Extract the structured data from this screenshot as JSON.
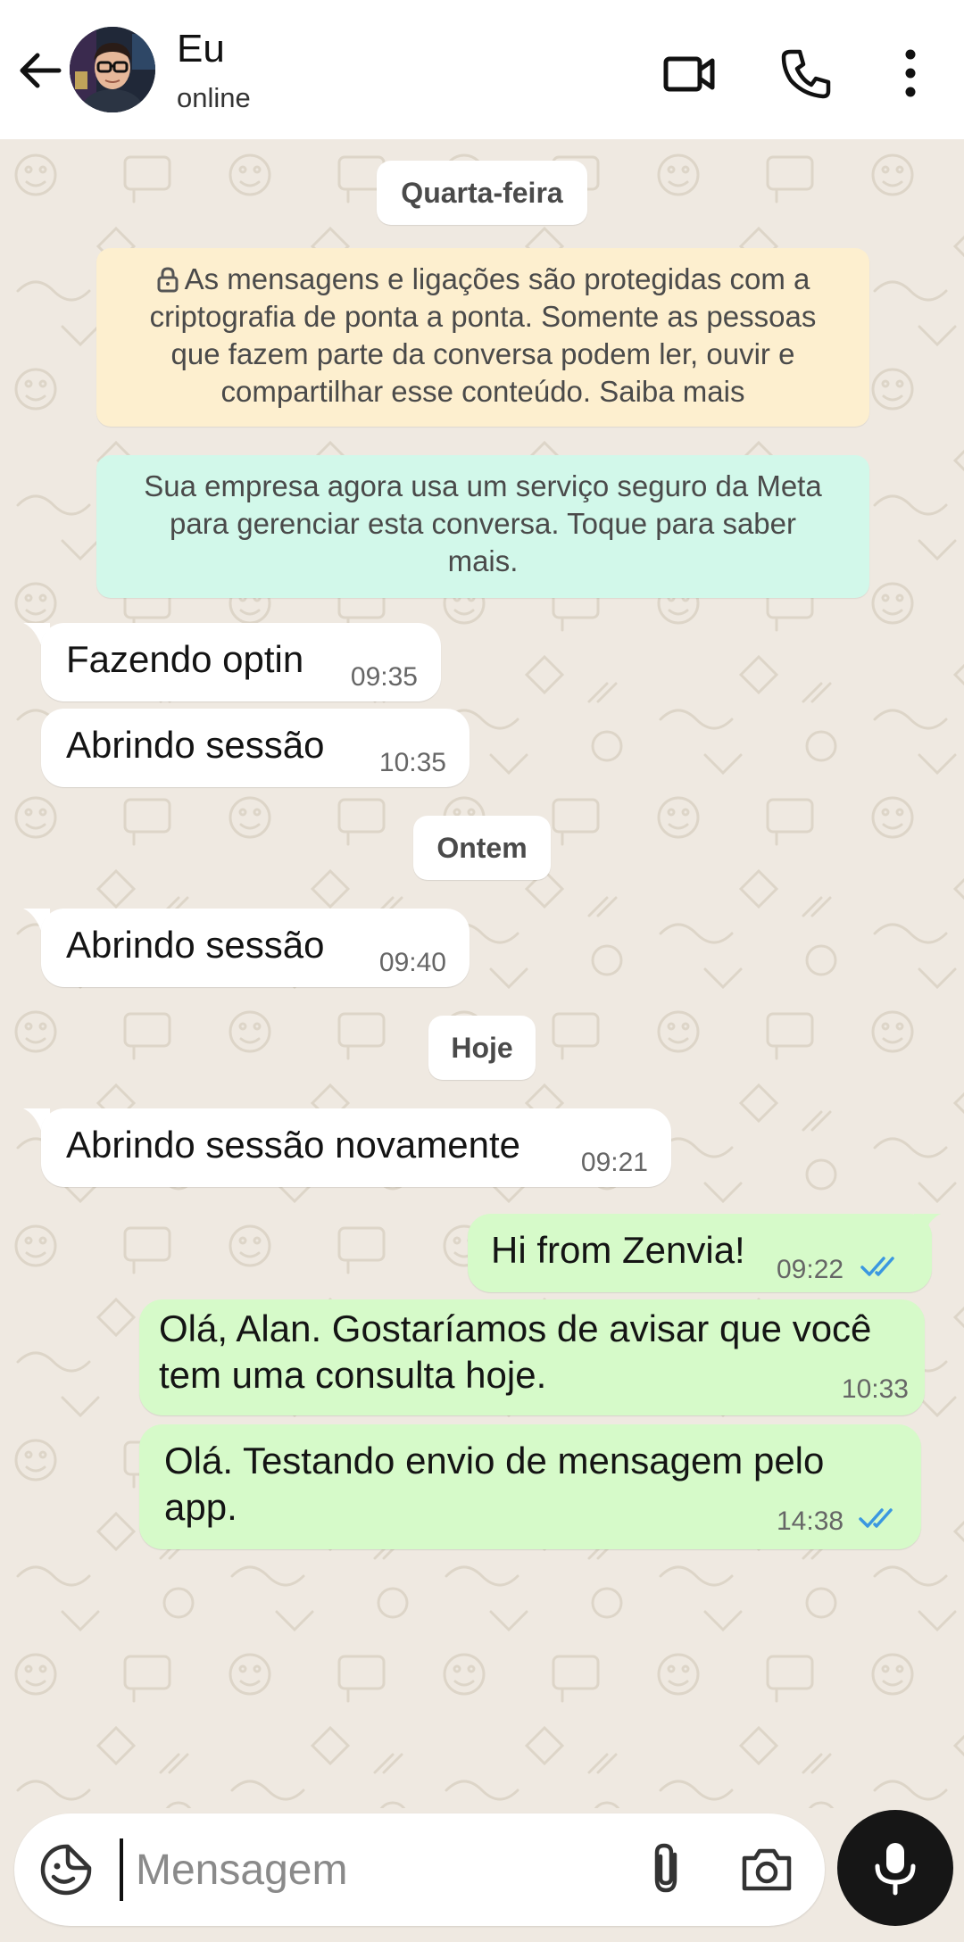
{
  "header": {
    "name": "Eu",
    "status": "online"
  },
  "chips": {
    "quarta": "Quarta-feira",
    "ontem": "Ontem",
    "hoje": "Hoje"
  },
  "notices": {
    "encryption_lines": [
      "As mensagens e ligações são protegidas com a",
      "criptografia de ponta a ponta. Somente as pessoas",
      "que fazem parte da conversa podem ler, ouvir e",
      "compartilhar esse conteúdo. Saiba mais"
    ],
    "meta_lines": [
      "Sua empresa agora usa um serviço seguro da Meta",
      "para gerenciar esta conversa. Toque para saber",
      "mais."
    ]
  },
  "messages": [
    {
      "text": "Fazendo optin",
      "time": "09:35"
    },
    {
      "text": "Abrindo sessão",
      "time": "10:35"
    },
    {
      "text": "Abrindo sessão",
      "time": "09:40"
    },
    {
      "text": "Abrindo sessão novamente",
      "time": "09:21"
    },
    {
      "text": "Hi from Zenvia!",
      "time": "09:22"
    },
    {
      "lines": [
        "Olá, Alan. Gostaríamos de avisar que você",
        "tem uma consulta hoje."
      ],
      "time": "10:33"
    },
    {
      "lines": [
        "Olá. Testando envio de mensagem pelo",
        "app."
      ],
      "time": "14:38"
    }
  ],
  "input": {
    "placeholder": "Mensagem"
  },
  "colors": {
    "wallpaper": "#efe9e1",
    "incoming_bubble": "#ffffff",
    "outgoing_bubble": "#d6fac9",
    "encryption_notice": "#fdefcf",
    "meta_notice": "#d2f8ea",
    "read_ticks": "#3b97e0",
    "mic_button": "#161616"
  },
  "icons": {
    "back": "arrow-left-icon",
    "video": "video-camera-icon",
    "call": "phone-icon",
    "menu": "more-vertical-icon",
    "lock": "lock-icon",
    "emoji": "sticker-smiley-icon",
    "attach": "paperclip-icon",
    "camera": "camera-icon",
    "mic": "microphone-icon"
  }
}
